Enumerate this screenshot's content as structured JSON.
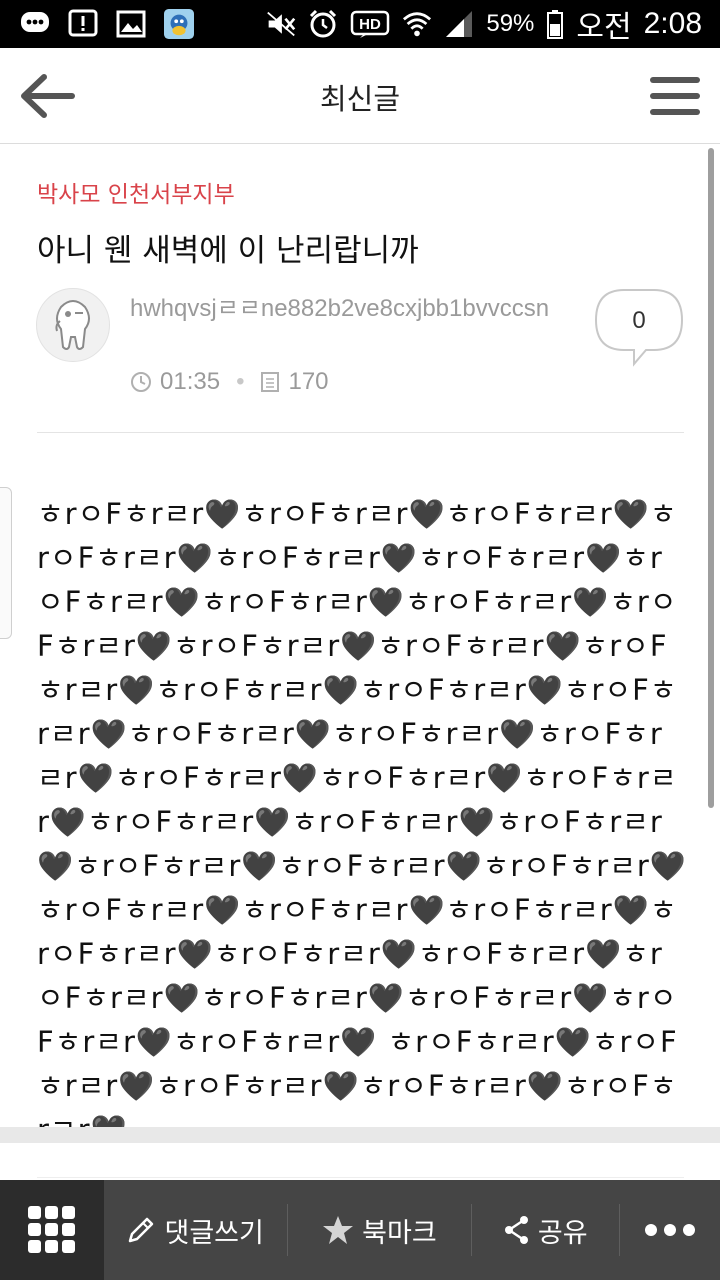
{
  "status_bar": {
    "battery": "59%",
    "ampm": "오전",
    "time": "2:08",
    "icons": [
      "message-icon",
      "alert-icon",
      "image-icon",
      "app-avatar-icon",
      "mute-icon",
      "alarm-icon",
      "hd-icon",
      "wifi-icon",
      "signal-icon",
      "battery-icon"
    ]
  },
  "app_bar": {
    "title": "최신글",
    "back_icon": "arrow-left-icon",
    "menu_icon": "hamburger-menu-icon"
  },
  "post": {
    "category": "박사모 인천서부지부",
    "title": "아니 웬 새벽에 이 난리랍니까",
    "author": "hwhqvsjㄹㄹne882b2ve8cxjbb1bvvccsn",
    "time": "01:35",
    "views": "170",
    "comment_count": "0",
    "body": "ㅎrㅇFㅎrㄹr🖤ㅎrㅇFㅎrㄹr🖤ㅎrㅇFㅎrㄹr🖤ㅎrㅇFㅎrㄹr🖤ㅎrㅇFㅎrㄹr🖤ㅎrㅇFㅎrㄹr🖤ㅎrㅇFㅎrㄹr🖤ㅎrㅇFㅎrㄹr🖤ㅎrㅇFㅎrㄹr🖤ㅎrㅇFㅎrㄹr🖤ㅎrㅇFㅎrㄹr🖤ㅎrㅇFㅎrㄹr🖤ㅎrㅇFㅎrㄹr🖤ㅎrㅇFㅎrㄹr🖤ㅎrㅇFㅎrㄹr🖤ㅎrㅇFㅎrㄹr🖤ㅎrㅇFㅎrㄹr🖤ㅎrㅇFㅎrㄹr🖤ㅎrㅇFㅎrㄹr🖤ㅎrㅇFㅎrㄹr🖤ㅎrㅇFㅎrㄹr🖤ㅎrㅇFㅎrㄹr🖤ㅎrㅇFㅎrㄹr🖤ㅎrㅇFㅎrㄹr🖤ㅎrㅇFㅎrㄹr🖤ㅎrㅇFㅎrㄹr🖤ㅎrㅇFㅎrㄹr🖤ㅎrㅇFㅎrㄹr🖤ㅎrㅇFㅎrㄹr🖤ㅎrㅇFㅎrㄹr🖤ㅎrㅇFㅎrㄹr🖤ㅎrㅇFㅎrㄹr🖤ㅎrㅇFㅎrㄹr🖤ㅎrㅇFㅎrㄹr🖤ㅎrㅇFㅎrㄹr🖤ㅎrㅇFㅎrㄹr🖤ㅎrㅇFㅎrㄹr🖤ㅎrㅇFㅎrㄹr🖤ㅎrㅇFㅎrㄹr🖤 ㅎrㅇFㅎrㄹr🖤ㅎrㅇFㅎrㄹr🖤ㅎrㅇFㅎrㄹr🖤ㅎrㅇFㅎrㄹr🖤ㅎrㅇFㅎrㄹr🖤"
  },
  "toolbar": {
    "grid_icon": "grid-apps-icon",
    "comment_label": "댓글쓰기",
    "comment_icon": "pencil-icon",
    "bookmark_label": "북마크",
    "bookmark_icon": "star-icon",
    "share_label": "공유",
    "share_icon": "share-icon",
    "more_icon": "more-dots-icon"
  },
  "colors": {
    "category": "#d9434a",
    "toolbar_bg": "#454545",
    "toolbar_grid_bg": "#2c2c2c",
    "meta_text": "#9a9a9a"
  }
}
